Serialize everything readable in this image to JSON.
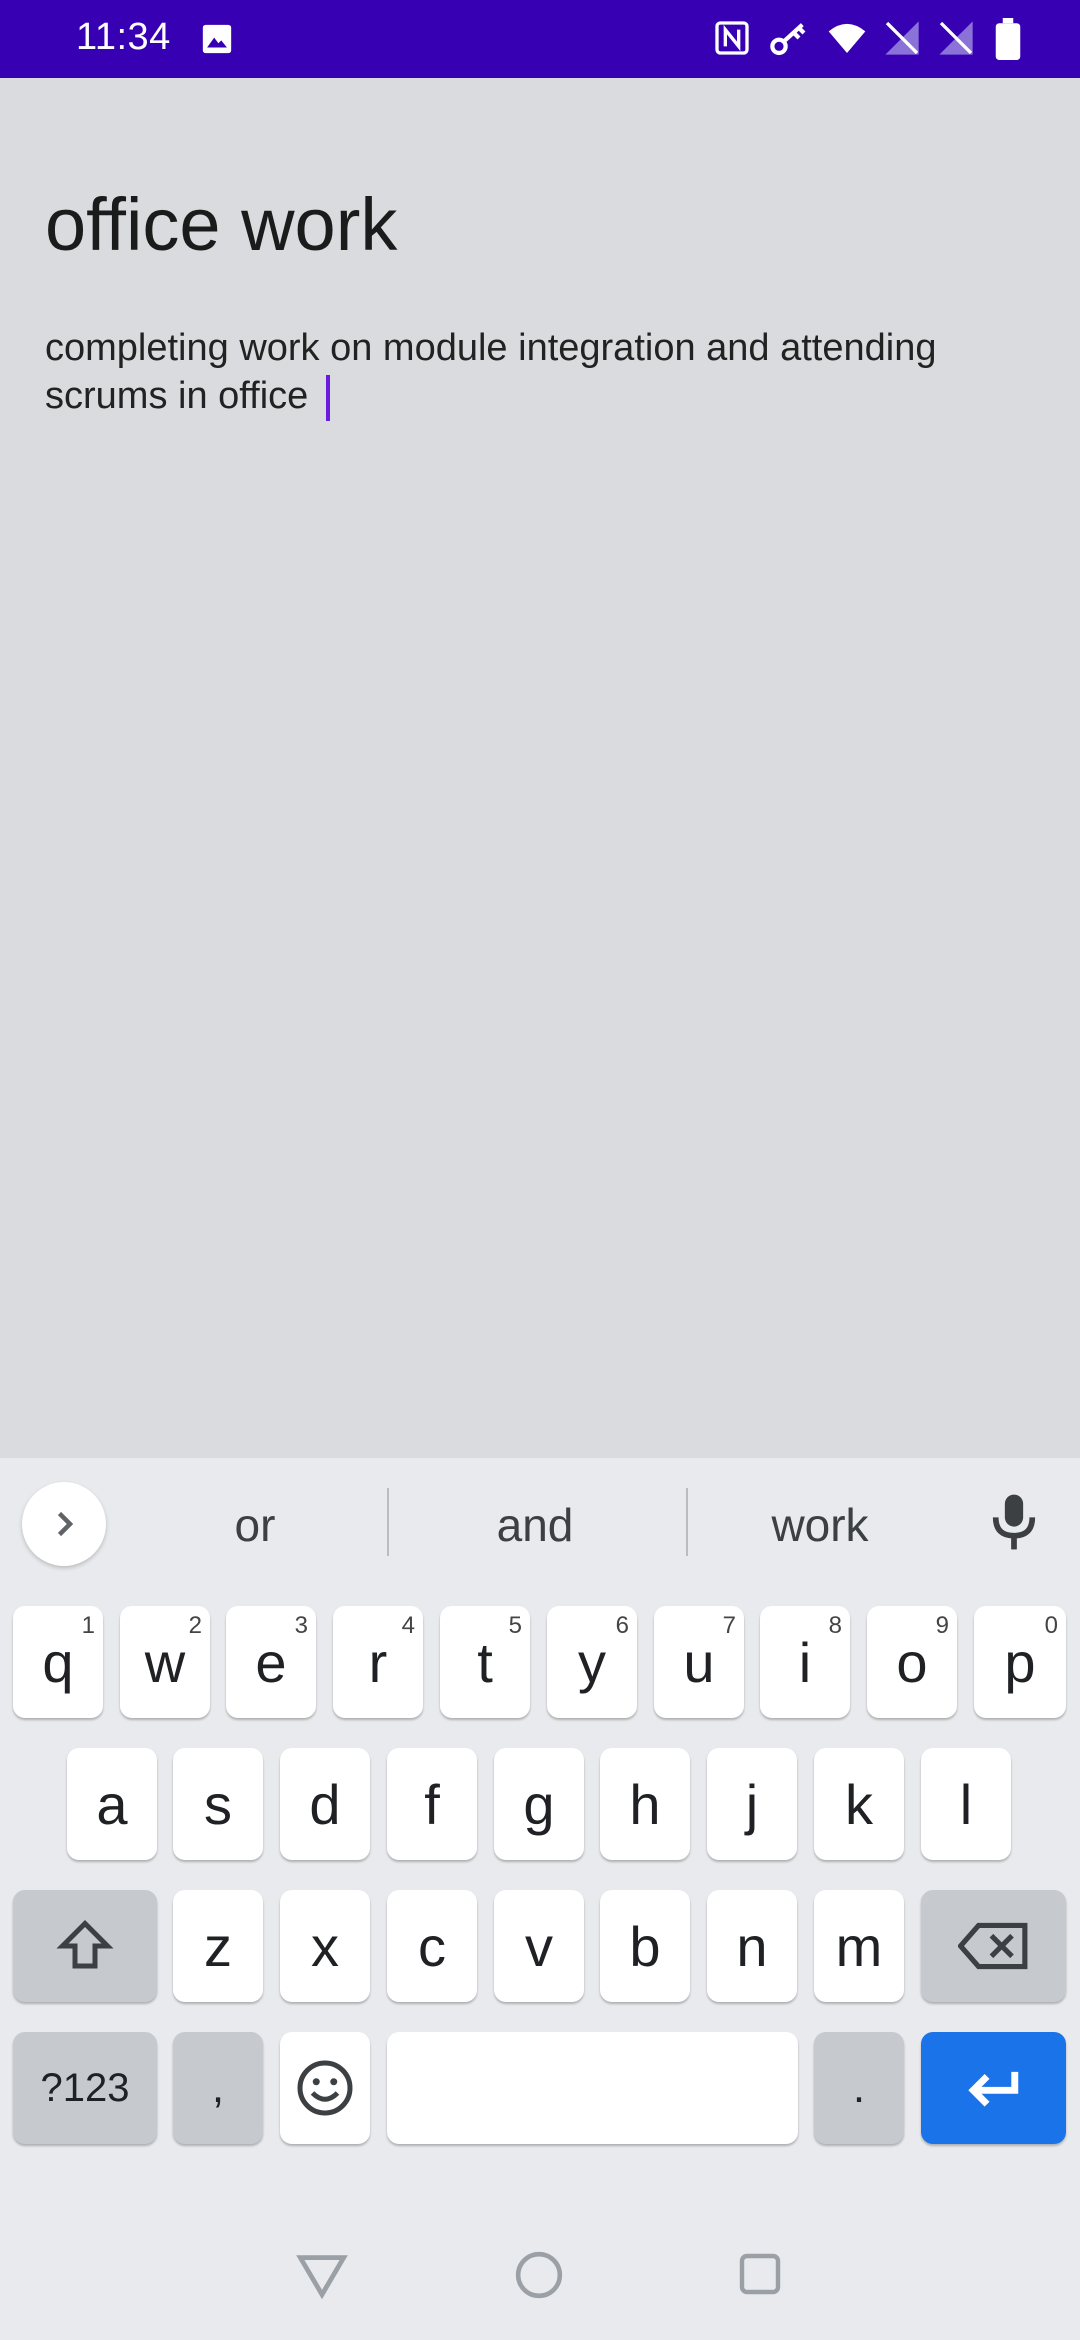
{
  "status_bar": {
    "time": "11:34",
    "icons": [
      "image-icon",
      "nfc-icon",
      "vpn-key-icon",
      "wifi-icon",
      "no-sim-icon",
      "no-sim-icon",
      "battery-icon"
    ],
    "background_color": "#3700b3"
  },
  "note": {
    "title": "office work",
    "body": "completing work on module integration and attending scrums in office"
  },
  "keyboard": {
    "suggestions": [
      "or",
      "and",
      "work"
    ],
    "row1": [
      {
        "label": "q",
        "num": "1"
      },
      {
        "label": "w",
        "num": "2"
      },
      {
        "label": "e",
        "num": "3"
      },
      {
        "label": "r",
        "num": "4"
      },
      {
        "label": "t",
        "num": "5"
      },
      {
        "label": "y",
        "num": "6"
      },
      {
        "label": "u",
        "num": "7"
      },
      {
        "label": "i",
        "num": "8"
      },
      {
        "label": "o",
        "num": "9"
      },
      {
        "label": "p",
        "num": "0"
      }
    ],
    "row2": [
      "a",
      "s",
      "d",
      "f",
      "g",
      "h",
      "j",
      "k",
      "l"
    ],
    "row3": [
      "z",
      "x",
      "c",
      "v",
      "b",
      "n",
      "m"
    ],
    "symbols_label": "?123",
    "comma_label": ",",
    "period_label": ".",
    "enter_color": "#1a73e8"
  },
  "nav": {
    "icons": [
      "back-triangle-icon",
      "home-circle-icon",
      "recents-square-icon"
    ]
  }
}
